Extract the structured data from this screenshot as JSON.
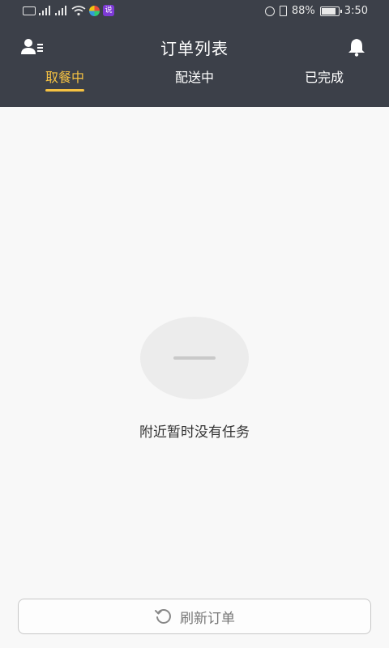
{
  "status_bar": {
    "time": "3:50",
    "battery": "88%",
    "app_badge": "说"
  },
  "header": {
    "title": "订单列表",
    "left_icon": "user-list-icon",
    "right_icon": "bell-icon"
  },
  "tabs": [
    {
      "label": "取餐中",
      "active": true
    },
    {
      "label": "配送中",
      "active": false
    },
    {
      "label": "已完成",
      "active": false
    }
  ],
  "empty_state": {
    "message": "附近暂时没有任务",
    "icon": "empty-placeholder-icon"
  },
  "refresh_button": {
    "label": "刷新订单",
    "icon": "refresh-icon"
  },
  "colors": {
    "header_bg": "#3c4049",
    "accent": "#f6c242",
    "page_bg": "#f8f8f8"
  }
}
